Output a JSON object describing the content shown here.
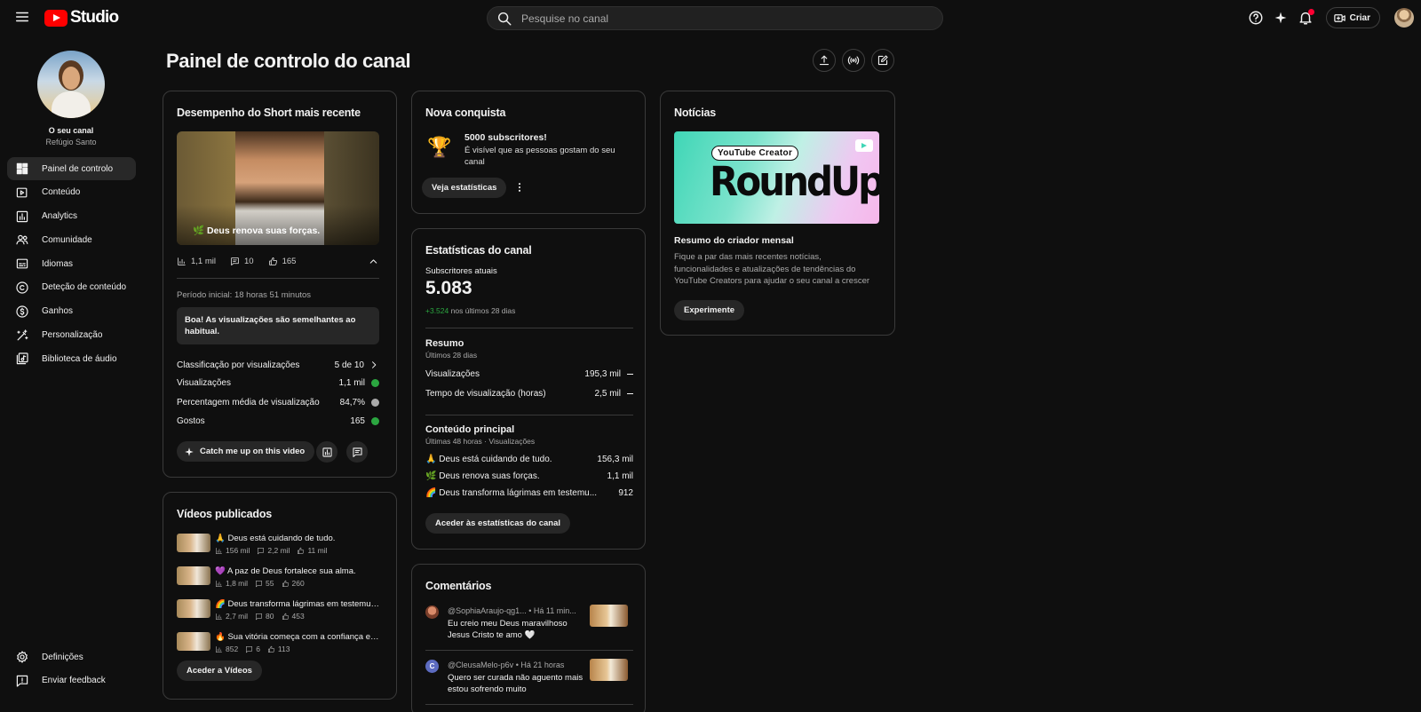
{
  "app": {
    "name": "Studio"
  },
  "search": {
    "placeholder": "Pesquise no canal"
  },
  "topbar": {
    "create_label": "Criar"
  },
  "channel": {
    "title": "O seu canal",
    "name": "Refúgio Santo"
  },
  "sidebar": {
    "items": [
      {
        "label": "Painel de controlo",
        "icon": "dashboard-icon",
        "active": true
      },
      {
        "label": "Conteúdo",
        "icon": "content-icon"
      },
      {
        "label": "Analytics",
        "icon": "analytics-icon"
      },
      {
        "label": "Comunidade",
        "icon": "community-icon"
      },
      {
        "label": "Idiomas",
        "icon": "subtitles-icon"
      },
      {
        "label": "Deteção de conteúdo",
        "icon": "copyright-icon"
      },
      {
        "label": "Ganhos",
        "icon": "dollar-icon"
      },
      {
        "label": "Personalização",
        "icon": "magic-wand-icon"
      },
      {
        "label": "Biblioteca de áudio",
        "icon": "audio-library-icon"
      }
    ],
    "bottom": [
      {
        "label": "Definições",
        "icon": "gear-icon"
      },
      {
        "label": "Enviar feedback",
        "icon": "feedback-icon"
      }
    ]
  },
  "page": {
    "title": "Painel de controlo do canal"
  },
  "short_perf": {
    "title": "Desempenho do Short mais recente",
    "thumb_caption": "🌿 Deus renova suas forças.",
    "views": "1,1 mil",
    "comments": "10",
    "likes": "165",
    "period": "Período inicial: 18 horas 51 minutos",
    "notice": "Boa! As visualizações são semelhantes ao habitual.",
    "rows": [
      {
        "label": "Classificação por visualizações",
        "value": "5 de 10"
      },
      {
        "label": "Visualizações",
        "value": "1,1 mil"
      },
      {
        "label": "Percentagem média de visualização",
        "value": "84,7%"
      },
      {
        "label": "Gostos",
        "value": "165"
      }
    ],
    "catch_up_label": "Catch me up on this video"
  },
  "published": {
    "title": "Vídeos publicados",
    "videos": [
      {
        "title": "🙏 Deus está cuidando de tudo.",
        "views": "156 mil",
        "comments": "2,2 mil",
        "likes": "11 mil"
      },
      {
        "title": "💜 A paz de Deus fortalece sua alma.",
        "views": "1,8 mil",
        "comments": "55",
        "likes": "260"
      },
      {
        "title": "🌈 Deus transforma lágrimas em testemunho",
        "views": "2,7 mil",
        "comments": "80",
        "likes": "453"
      },
      {
        "title": "🔥 Sua vitória começa com a confiança em Deus",
        "views": "852",
        "comments": "6",
        "likes": "113"
      }
    ],
    "button": "Aceder a Vídeos"
  },
  "achievement": {
    "title": "Nova conquista",
    "headline": "5000 subscritores!",
    "text": "É visível que as pessoas gostam do seu canal",
    "button": "Veja estatísticas"
  },
  "stats": {
    "title": "Estatísticas do canal",
    "subs_label": "Subscritores atuais",
    "subs_value": "5.083",
    "subs_delta": "+3.524",
    "subs_delta_suffix": "nos últimos 28 dias",
    "summary_title": "Resumo",
    "summary_sub": "Últimos 28 dias",
    "summary": [
      {
        "label": "Visualizações",
        "value": "195,3 mil"
      },
      {
        "label": "Tempo de visualização (horas)",
        "value": "2,5 mil"
      }
    ],
    "top_title": "Conteúdo principal",
    "top_sub": "Últimas 48 horas · Visualizações",
    "top": [
      {
        "label": "🙏 Deus está cuidando de tudo.",
        "value": "156,3 mil"
      },
      {
        "label": "🌿 Deus renova suas forças.",
        "value": "1,1 mil"
      },
      {
        "label": "🌈 Deus transforma lágrimas em testemu...",
        "value": "912"
      }
    ],
    "button": "Aceder às estatísticas do canal"
  },
  "comments": {
    "title": "Comentários",
    "items": [
      {
        "author": "@SophiaAraujo-qg1...",
        "time": "• Há 11 min...",
        "text": "Eu creio meu Deus maravilhoso Jesus Cristo te amo 🤍",
        "avatar_color": "#b06a4a",
        "initial": ""
      },
      {
        "author": "@CleusaMelo-p6v",
        "time": "• Há 21 horas",
        "text": "Quero ser curada não aguento mais estou sofrendo muito",
        "avatar_color": "#5c6bc0",
        "initial": "C"
      }
    ]
  },
  "news": {
    "title": "Notícias",
    "banner_badge": "YouTube Creator",
    "banner_big": "RoundUp",
    "headline": "Resumo do criador mensal",
    "text": "Fique a par das mais recentes notícias, funcionalidades e atualizações de tendências do YouTube Creators para ajudar o seu canal a crescer",
    "button": "Experimente"
  }
}
